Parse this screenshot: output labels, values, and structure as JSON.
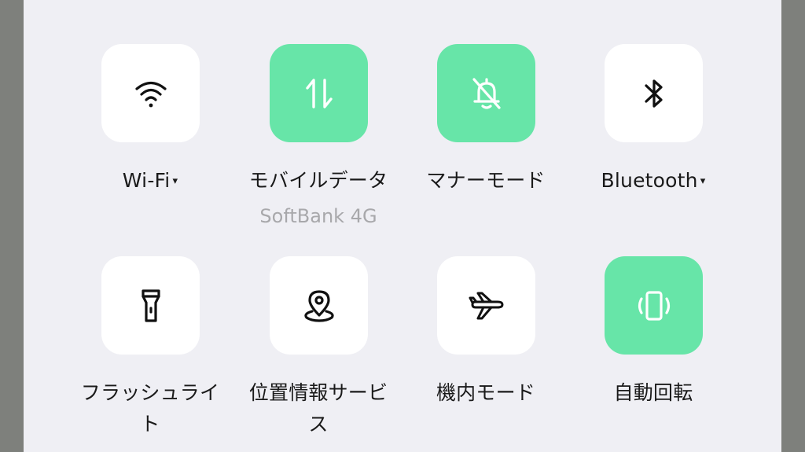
{
  "colors": {
    "tile_inactive": "#ffffff",
    "tile_active": "#67e5a8",
    "panel_background": "#efeff4",
    "icon_inactive": "#111111",
    "icon_active": "#ffffff",
    "sublabel": "#a8a8ab"
  },
  "tiles": [
    {
      "id": "wifi",
      "label": "Wi-Fi",
      "dropdown": "▾",
      "active": false,
      "icon": "wifi-icon"
    },
    {
      "id": "mobile-data",
      "label": "モバイルデータ",
      "sublabel": "SoftBank 4G",
      "active": true,
      "icon": "data-transfer-icon"
    },
    {
      "id": "manner-mode",
      "label": "マナーモード",
      "active": true,
      "icon": "bell-off-icon"
    },
    {
      "id": "bluetooth",
      "label": "Bluetooth",
      "dropdown": "▾",
      "active": false,
      "icon": "bluetooth-icon"
    },
    {
      "id": "flashlight",
      "label_lines": [
        "フラッシュライ",
        "ト"
      ],
      "active": false,
      "icon": "flashlight-icon"
    },
    {
      "id": "location",
      "label_lines": [
        "位置情報サービ",
        "ス"
      ],
      "active": false,
      "icon": "location-pin-icon"
    },
    {
      "id": "airplane",
      "label": "機内モード",
      "active": false,
      "icon": "airplane-icon"
    },
    {
      "id": "auto-rotate",
      "label": "自動回転",
      "active": true,
      "icon": "auto-rotate-icon"
    }
  ]
}
